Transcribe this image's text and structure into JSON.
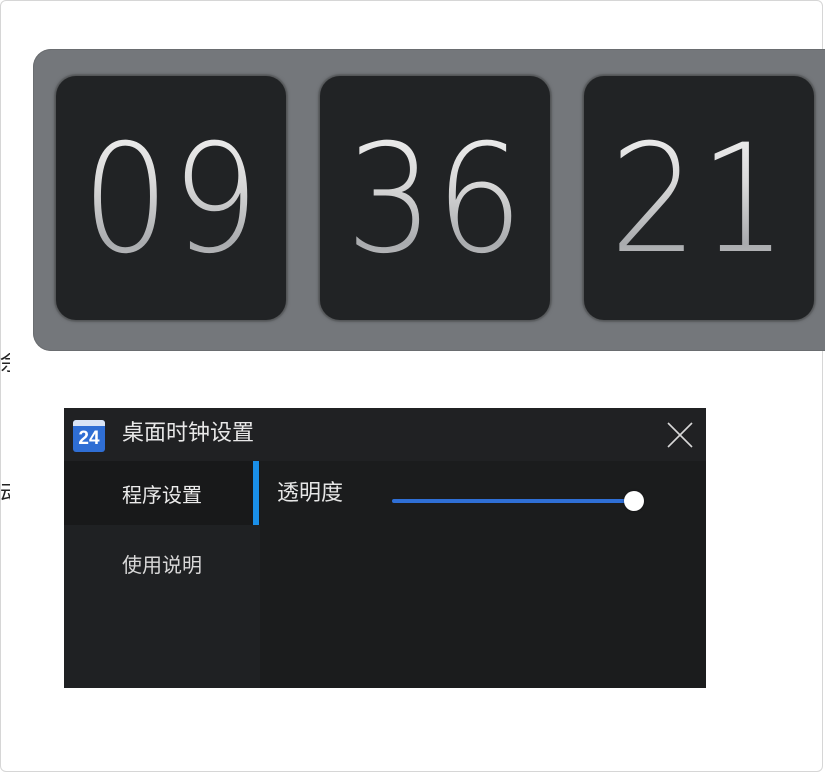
{
  "clock": {
    "hours": "09",
    "minutes": "36",
    "seconds": "21"
  },
  "side_fragments": [
    "余",
    "动"
  ],
  "settings": {
    "app_icon_text": "24",
    "title": "桌面时钟设置",
    "close_icon": "close-icon",
    "nav": [
      {
        "label": "程序设置",
        "active": true
      },
      {
        "label": "使用说明",
        "active": false
      }
    ],
    "opacity": {
      "label": "透明度",
      "value_fraction": 1.0
    },
    "colors": {
      "accent_indicator": "#1a8fe8",
      "slider_fill": "#2f6fd6",
      "clock_frame": "#74777b",
      "digit_card": "#212325"
    }
  }
}
